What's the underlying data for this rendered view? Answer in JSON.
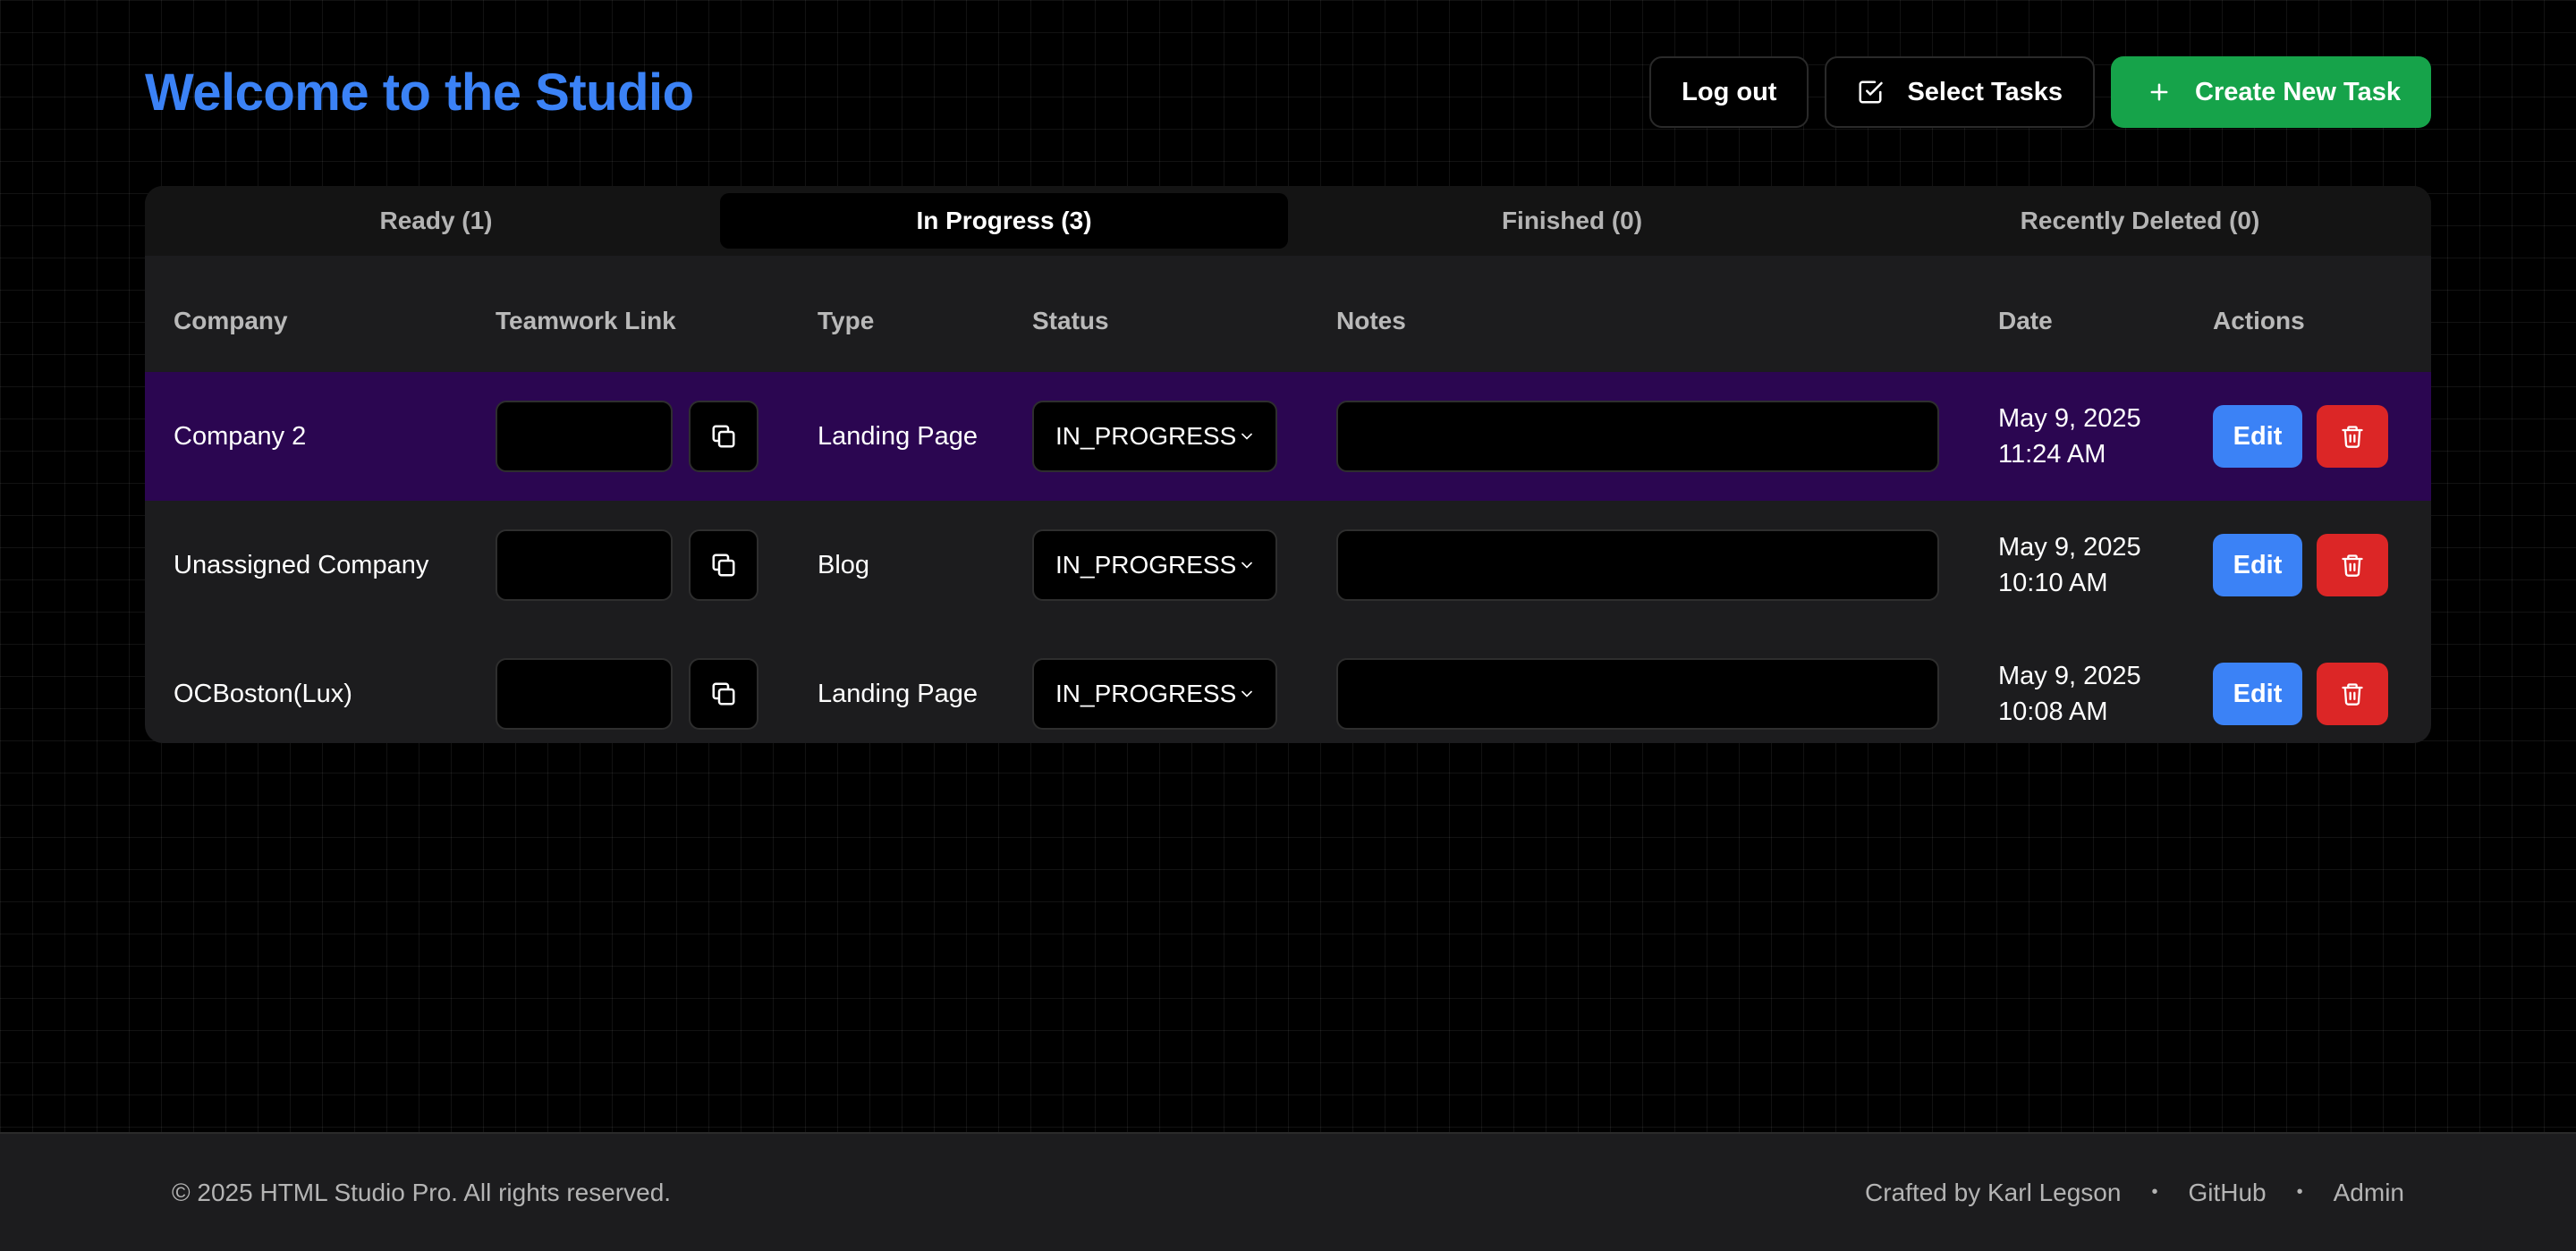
{
  "header": {
    "title": "Welcome to the Studio",
    "logout_label": "Log out",
    "select_tasks_label": "Select Tasks",
    "create_label": "Create New Task"
  },
  "tabs": [
    {
      "label": "Ready (1)",
      "active": false
    },
    {
      "label": "In Progress (3)",
      "active": true
    },
    {
      "label": "Finished (0)",
      "active": false
    },
    {
      "label": "Recently Deleted (0)",
      "active": false
    }
  ],
  "table": {
    "columns": [
      "Company",
      "Teamwork Link",
      "Type",
      "Status",
      "Notes",
      "Date",
      "Actions"
    ],
    "rows": [
      {
        "company": "Company 2",
        "link": "",
        "type": "Landing Page",
        "status": "IN_PROGRESS",
        "notes": "",
        "date": "May 9, 2025",
        "time": "11:24 AM",
        "edit_label": "Edit",
        "highlighted": true
      },
      {
        "company": "Unassigned Company",
        "link": "",
        "type": "Blog",
        "status": "IN_PROGRESS",
        "notes": "",
        "date": "May 9, 2025",
        "time": "10:10 AM",
        "edit_label": "Edit",
        "highlighted": false
      },
      {
        "company": "OCBoston(Lux)",
        "link": "",
        "type": "Landing Page",
        "status": "IN_PROGRESS",
        "notes": "",
        "date": "May 9, 2025",
        "time": "10:08 AM",
        "edit_label": "Edit",
        "highlighted": false
      }
    ]
  },
  "footer": {
    "copyright": "© 2025 HTML Studio Pro. All rights reserved.",
    "crafted": "Crafted by Karl Legson",
    "github": "GitHub",
    "admin": "Admin"
  },
  "colors": {
    "accent": "#3b82f6",
    "create_green": "#16a34a",
    "delete_red": "#dc2626",
    "highlight_row": "#2b0651"
  },
  "icons": {
    "select_tasks": "checkbox-icon",
    "create": "plus-icon",
    "copy": "copy-icon",
    "status": "chevron-down-icon",
    "delete": "trash-icon"
  }
}
